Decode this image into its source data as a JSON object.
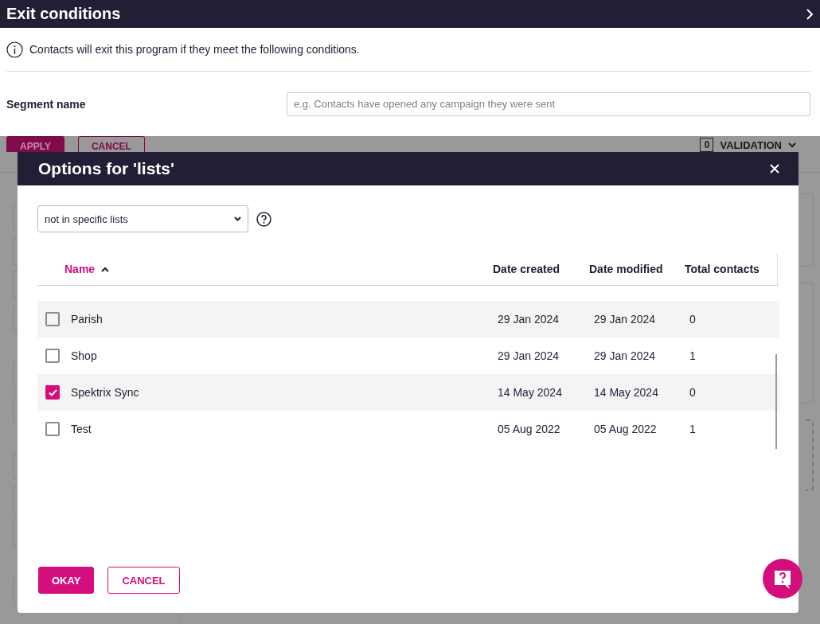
{
  "header": {
    "title": "Exit conditions"
  },
  "info": {
    "text": "Contacts will exit this program if they meet the following conditions."
  },
  "segment": {
    "label": "Segment name",
    "placeholder": "e.g. Contacts have opened any campaign they were sent"
  },
  "background": {
    "buttons": [
      {
        "label": "APPLY",
        "kind": "primary"
      },
      {
        "label": "CANCEL",
        "kind": "outline"
      }
    ],
    "validation": {
      "count": "0",
      "label": "VALIDATION"
    }
  },
  "modal": {
    "title": "Options for 'lists'",
    "filter": {
      "value": "not in specific lists"
    },
    "columns": [
      {
        "label": "Name",
        "sorted": true
      },
      {
        "label": "Date created",
        "sorted": false
      },
      {
        "label": "Date modified",
        "sorted": false
      },
      {
        "label": "Total contacts",
        "sorted": false
      }
    ],
    "rows": [
      {
        "name": "Parish",
        "created": "29 Jan 2024",
        "modified": "29 Jan 2024",
        "total": "0",
        "checked": false
      },
      {
        "name": "Shop",
        "created": "29 Jan 2024",
        "modified": "29 Jan 2024",
        "total": "1",
        "checked": false
      },
      {
        "name": "Spektrix Sync",
        "created": "14 May 2024",
        "modified": "14 May 2024",
        "total": "0",
        "checked": true
      },
      {
        "name": "Test",
        "created": "05 Aug 2022",
        "modified": "05 Aug 2022",
        "total": "1",
        "checked": false
      }
    ],
    "buttons": [
      {
        "label": "OKAY",
        "kind": "primary"
      },
      {
        "label": "CANCEL",
        "kind": "outline"
      }
    ]
  }
}
